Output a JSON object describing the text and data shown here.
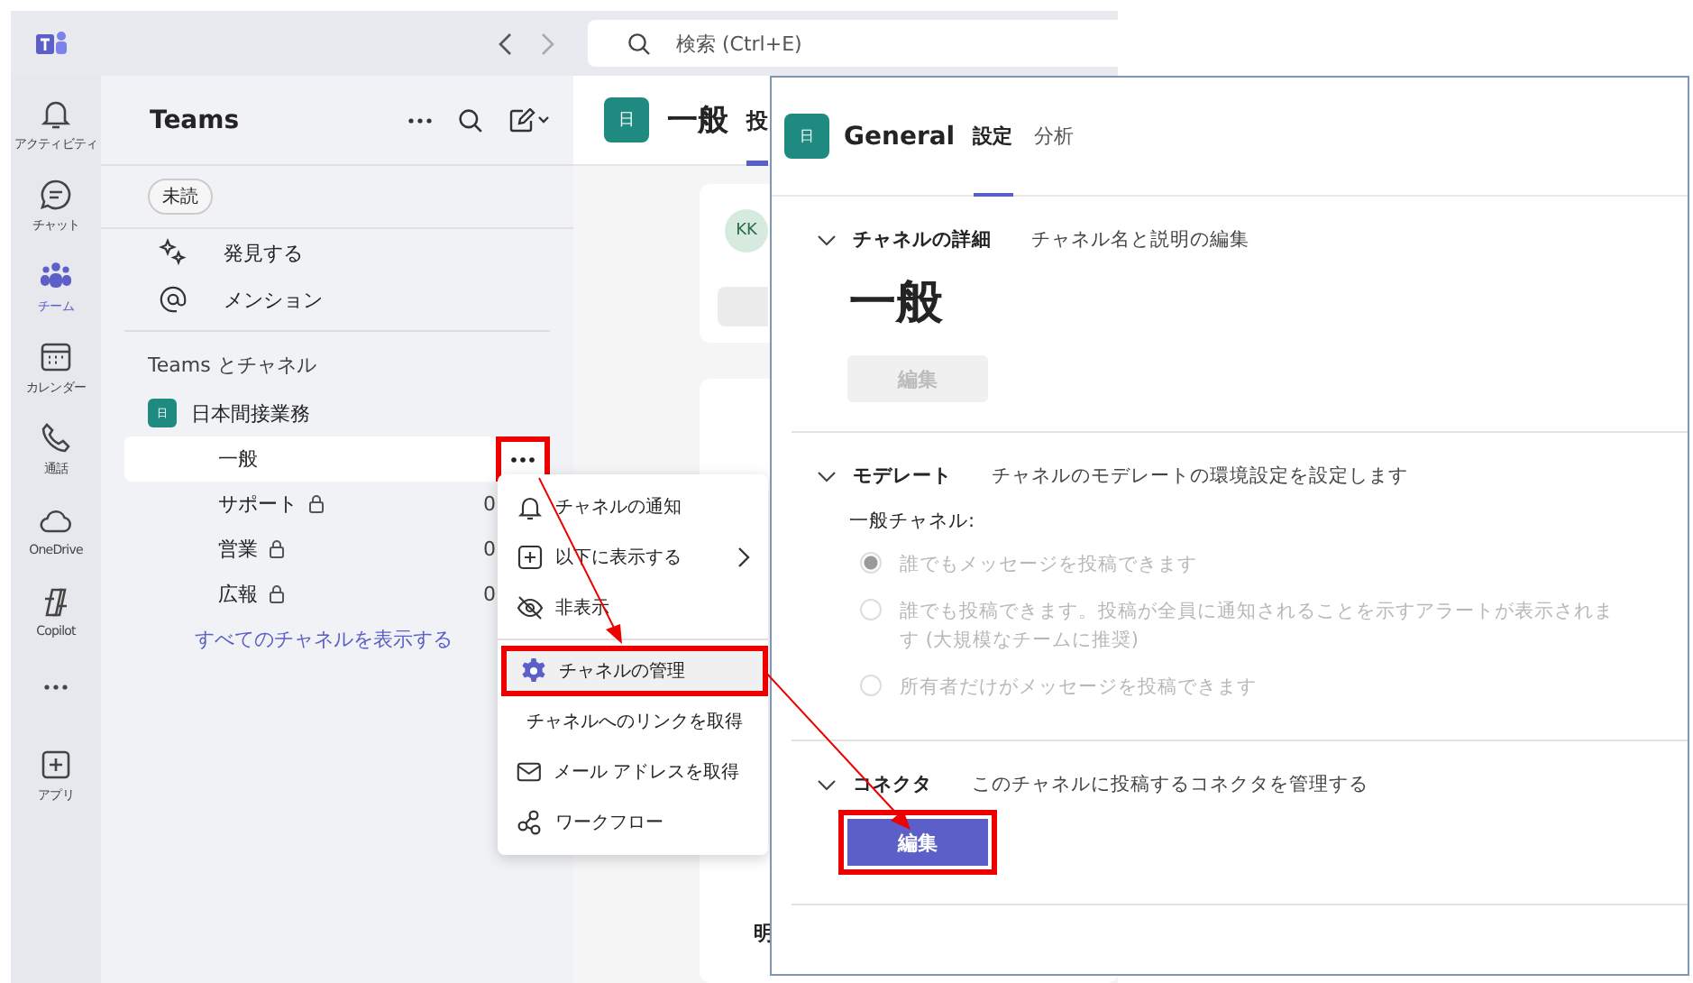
{
  "title_bar": {
    "search": {
      "placeholder": "検索 (Ctrl+E)"
    }
  },
  "rail": [
    {
      "label": "アクティビティ",
      "kind": "bell",
      "selected": false
    },
    {
      "label": "チャット",
      "kind": "chat",
      "selected": false
    },
    {
      "label": "チーム",
      "kind": "teams",
      "selected": true
    },
    {
      "label": "カレンダー",
      "kind": "calendar",
      "selected": false
    },
    {
      "label": "通話",
      "kind": "call",
      "selected": false
    },
    {
      "label": "OneDrive",
      "kind": "cloud",
      "selected": false
    },
    {
      "label": "Copilot",
      "kind": "copilot",
      "selected": false
    },
    {
      "label": "アプリ",
      "kind": "apps",
      "selected": false
    }
  ],
  "teams_panel": {
    "title": "Teams",
    "filter_chip": "未読",
    "quick_links": [
      {
        "label": "発見する",
        "kind": "discover"
      },
      {
        "label": "メンション",
        "kind": "mention"
      }
    ],
    "section_title": "Teams とチャネル",
    "team": {
      "avatar": "日",
      "name": "日本間接業務"
    },
    "channels": [
      {
        "name": "一般",
        "selected": true,
        "private": false,
        "more_highlighted": true
      },
      {
        "name": "サポート",
        "selected": false,
        "private": true,
        "column_3": "0"
      },
      {
        "name": "営業",
        "selected": false,
        "private": true,
        "column_3": "0"
      },
      {
        "name": "広報",
        "selected": false,
        "private": true,
        "column_3": "0"
      }
    ],
    "show_all_link": "すべてのチャネルを表示する"
  },
  "main": {
    "avatar": "日",
    "title": "一般",
    "tabs": [
      {
        "label": "投",
        "selected": true
      }
    ],
    "card_avatar": "KK",
    "footer_text": "明"
  },
  "context_menu": {
    "groups": [
      [
        {
          "label": "チャネルの通知",
          "kind": "bell",
          "submenu": false,
          "highlighted": false
        },
        {
          "label": "以下に表示する",
          "kind": "plus",
          "submenu": true,
          "highlighted": false
        },
        {
          "label": "非表示",
          "kind": "hide",
          "submenu": false,
          "highlighted": false
        }
      ],
      [
        {
          "label": "チャネルの管理",
          "kind": "gear",
          "submenu": false,
          "highlighted": true
        },
        {
          "label": "チャネルへのリンクを取得",
          "kind": "link",
          "submenu": false,
          "highlighted": false
        },
        {
          "label": "メール アドレスを取得",
          "kind": "mail",
          "submenu": false,
          "highlighted": false
        },
        {
          "label": "ワークフロー",
          "kind": "workflow",
          "submenu": false,
          "highlighted": false
        }
      ]
    ]
  },
  "settings_panel": {
    "avatar": "日",
    "title": "General",
    "tabs": [
      {
        "label": "設定",
        "selected": true
      },
      {
        "label": "分析",
        "selected": false
      }
    ],
    "sections": [
      {
        "kind": "details",
        "title": "チャネルの詳細",
        "description": "チャネル名と説明の編集",
        "expanded": true,
        "channel_name": "一般",
        "button": {
          "label": "編集",
          "disabled": true,
          "highlighted": false
        }
      },
      {
        "kind": "moderation",
        "title": "モデレート",
        "description": "チャネルのモデレートの環境設定を設定します",
        "expanded": true,
        "group_label": "一般チャネル:",
        "options": [
          {
            "label": "誰でもメッセージを投稿できます",
            "selected": true,
            "disabled": true
          },
          {
            "label": "誰でも投稿できます。投稿が全員に通知されることを示すアラートが表示されます (大規模なチームに推奨)",
            "selected": false,
            "disabled": true
          },
          {
            "label": "所有者だけがメッセージを投稿できます",
            "selected": false,
            "disabled": true
          }
        ]
      },
      {
        "kind": "connectors",
        "title": "コネクタ",
        "description": "このチャネルに投稿するコネクタを管理する",
        "expanded": true,
        "button": {
          "label": "編集",
          "disabled": false,
          "highlighted": true
        }
      }
    ]
  }
}
